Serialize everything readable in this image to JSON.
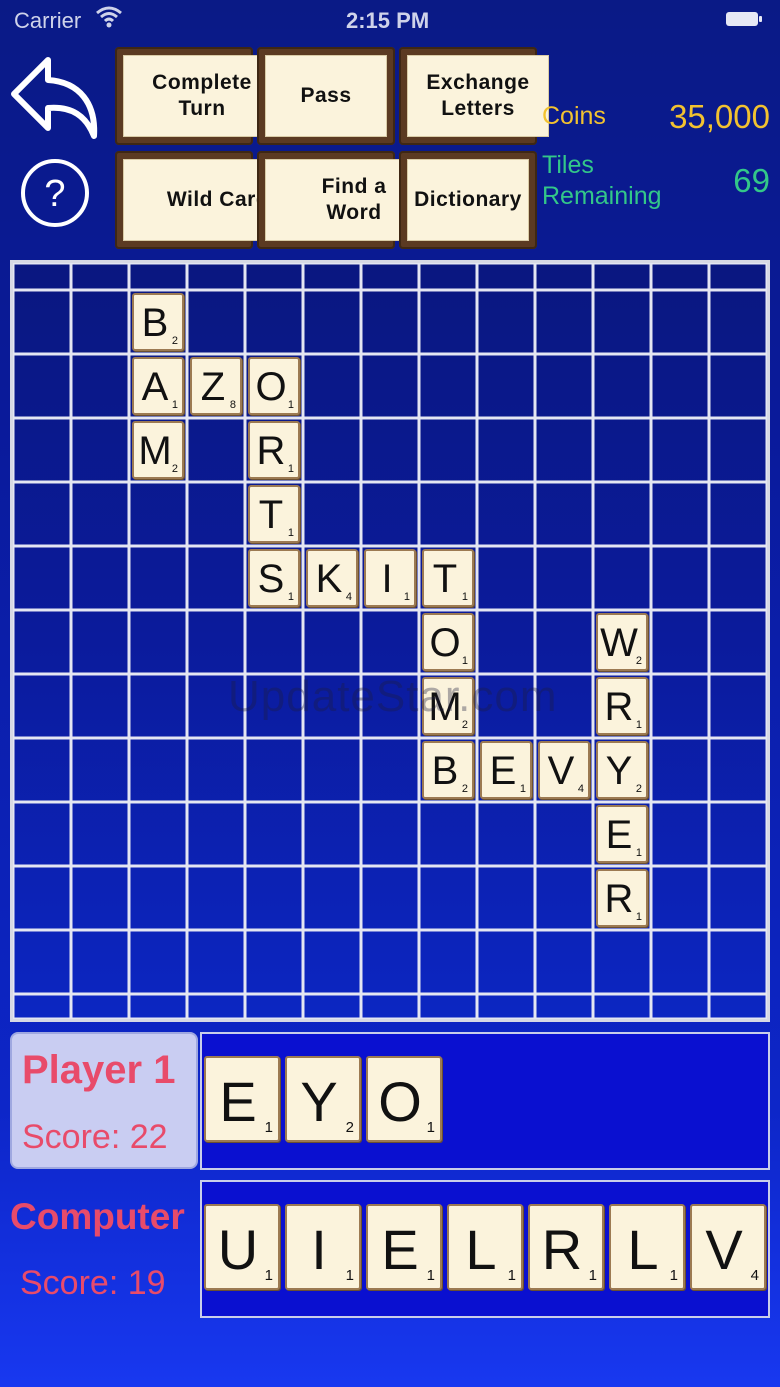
{
  "status_bar": {
    "carrier": "Carrier",
    "time": "2:15 PM"
  },
  "buttons": {
    "complete_turn": "Complete Turn",
    "pass": "Pass",
    "exchange_letters": "Exchange Letters",
    "wild_card": "Wild Card",
    "find_a_word": "Find a Word",
    "dictionary": "Dictionary"
  },
  "stats": {
    "coins_label": "Coins",
    "coins_value": "35,000",
    "tiles_label": "Tiles Remaining",
    "tiles_value": "69"
  },
  "board": {
    "tiles": [
      {
        "letter": "B",
        "points": "2",
        "row": 0,
        "col": 2
      },
      {
        "letter": "A",
        "points": "1",
        "row": 1,
        "col": 2
      },
      {
        "letter": "Z",
        "points": "8",
        "row": 1,
        "col": 3
      },
      {
        "letter": "O",
        "points": "1",
        "row": 1,
        "col": 4
      },
      {
        "letter": "M",
        "points": "2",
        "row": 2,
        "col": 2
      },
      {
        "letter": "R",
        "points": "1",
        "row": 2,
        "col": 4
      },
      {
        "letter": "T",
        "points": "1",
        "row": 3,
        "col": 4
      },
      {
        "letter": "S",
        "points": "1",
        "row": 4,
        "col": 4
      },
      {
        "letter": "K",
        "points": "4",
        "row": 4,
        "col": 5
      },
      {
        "letter": "I",
        "points": "1",
        "row": 4,
        "col": 6
      },
      {
        "letter": "T",
        "points": "1",
        "row": 4,
        "col": 7
      },
      {
        "letter": "O",
        "points": "1",
        "row": 5,
        "col": 7
      },
      {
        "letter": "W",
        "points": "2",
        "row": 5,
        "col": 10
      },
      {
        "letter": "M",
        "points": "2",
        "row": 6,
        "col": 7
      },
      {
        "letter": "R",
        "points": "1",
        "row": 6,
        "col": 10
      },
      {
        "letter": "B",
        "points": "2",
        "row": 7,
        "col": 7
      },
      {
        "letter": "E",
        "points": "1",
        "row": 7,
        "col": 8
      },
      {
        "letter": "V",
        "points": "4",
        "row": 7,
        "col": 9
      },
      {
        "letter": "Y",
        "points": "2",
        "row": 7,
        "col": 10
      },
      {
        "letter": "E",
        "points": "1",
        "row": 8,
        "col": 10
      },
      {
        "letter": "R",
        "points": "1",
        "row": 9,
        "col": 10
      }
    ]
  },
  "watermark": "UpdateStar.com",
  "player1": {
    "name": "Player 1",
    "score": "Score: 22",
    "rack": [
      {
        "letter": "E",
        "points": "1"
      },
      {
        "letter": "Y",
        "points": "2"
      },
      {
        "letter": "O",
        "points": "1"
      }
    ]
  },
  "computer": {
    "name": "Computer",
    "score": "Score: 19",
    "rack": [
      {
        "letter": "U",
        "points": "1"
      },
      {
        "letter": "I",
        "points": "1"
      },
      {
        "letter": "E",
        "points": "1"
      },
      {
        "letter": "L",
        "points": "1"
      },
      {
        "letter": "R",
        "points": "1"
      },
      {
        "letter": "L",
        "points": "1"
      },
      {
        "letter": "V",
        "points": "4"
      }
    ]
  }
}
